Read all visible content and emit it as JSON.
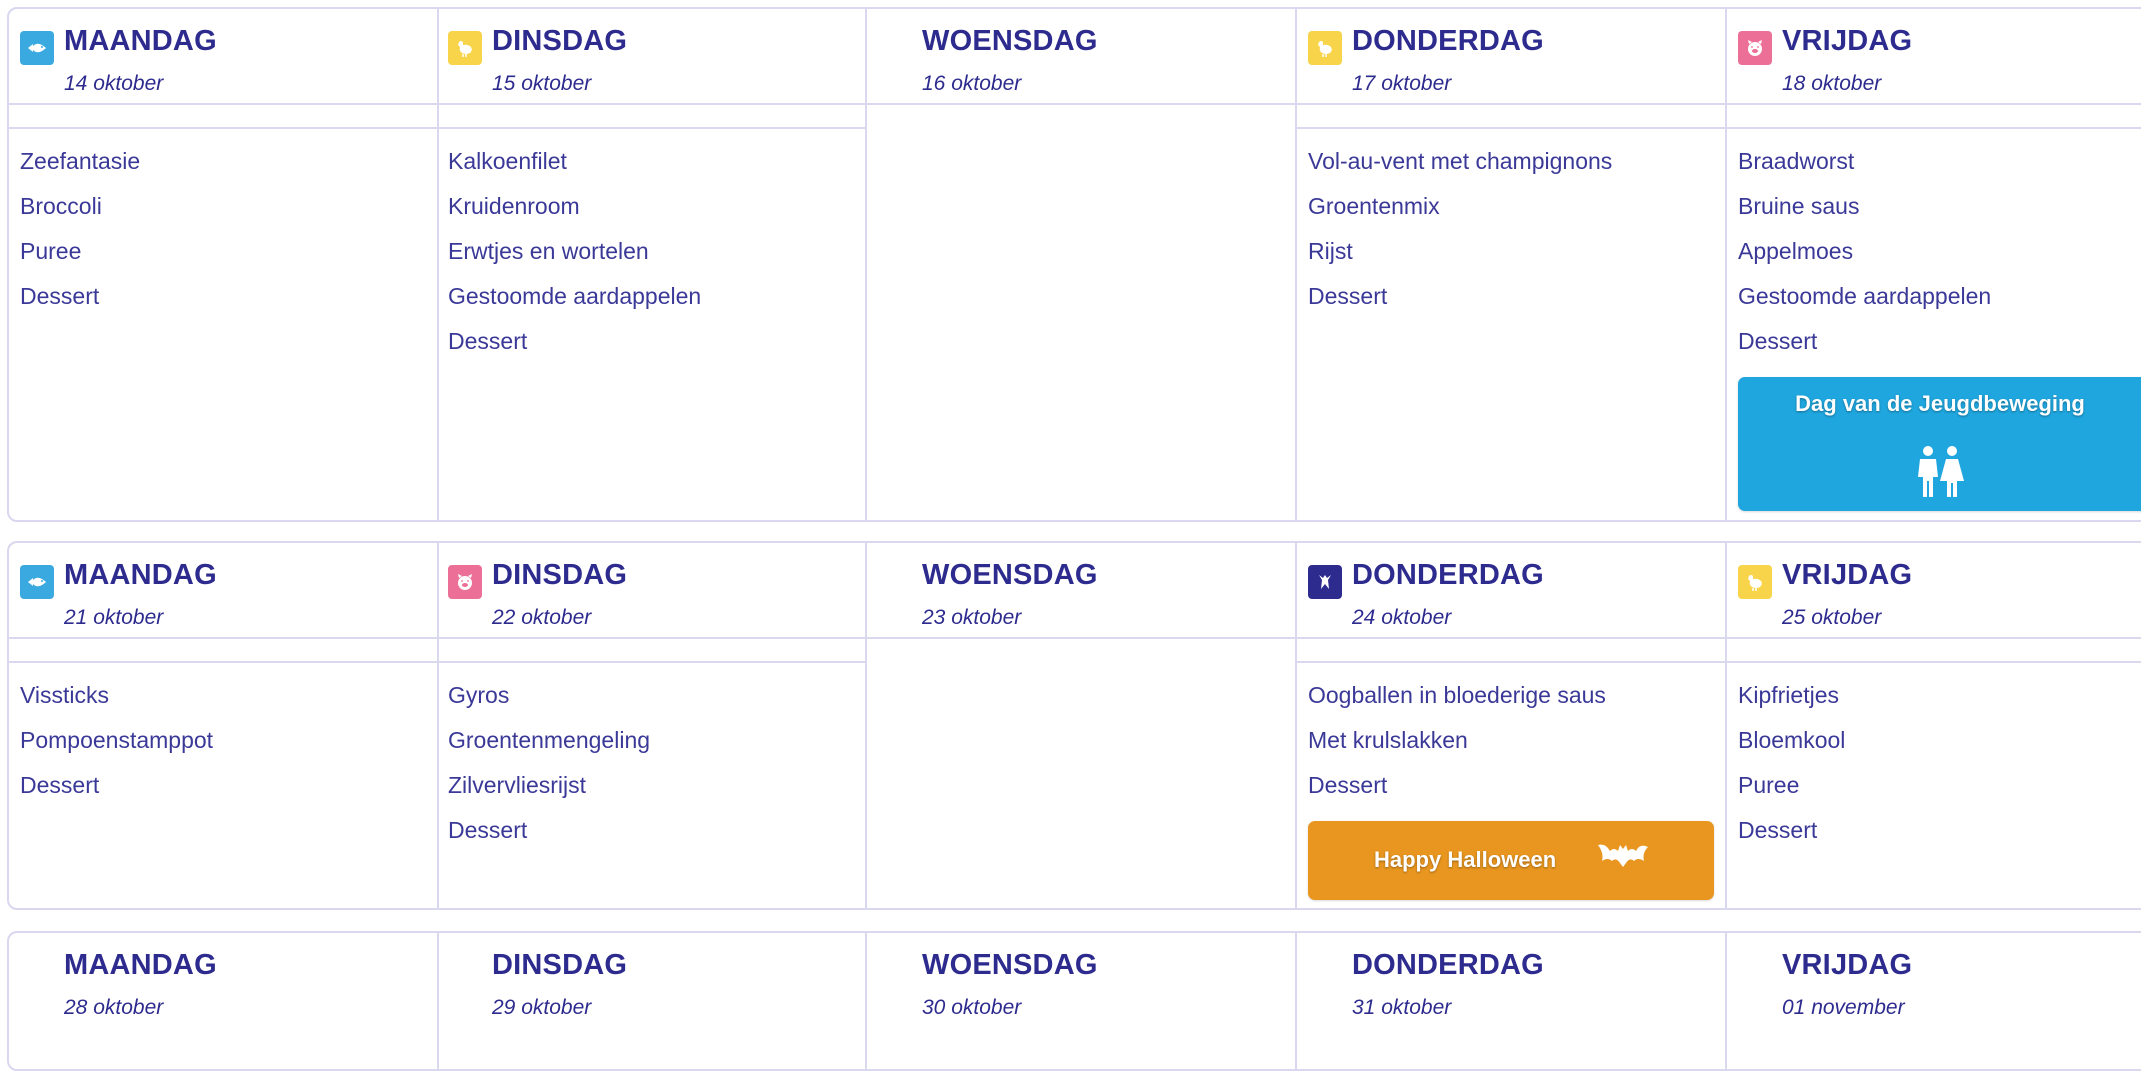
{
  "colors": {
    "primary_text": "#2e2b8f",
    "border": "#d9d8ee",
    "fish_badge": "#3aa9df",
    "poultry_badge": "#f7d44a",
    "pork_badge": "#ec6f97",
    "halloween_badge": "#2e2b8f",
    "youth_banner": "#1fa6de",
    "halloween_banner": "#e8961f"
  },
  "weeks": [
    {
      "days": [
        {
          "name": "MAANDAG",
          "date": "14 oktober",
          "icon": "fish-icon",
          "items": [
            "Zeefantasie",
            "Broccoli",
            "Puree",
            "Dessert"
          ]
        },
        {
          "name": "DINSDAG",
          "date": "15 oktober",
          "icon": "chicken-icon",
          "items": [
            "Kalkoenfilet",
            "Kruidenroom",
            "Erwtjes en wortelen",
            "Gestoomde aardappelen",
            "Dessert"
          ]
        },
        {
          "name": "WOENSDAG",
          "date": "16 oktober",
          "icon": "",
          "items": []
        },
        {
          "name": "DONDERDAG",
          "date": "17 oktober",
          "icon": "chicken-icon",
          "items": [
            "Vol-au-vent met champignons",
            "Groentenmix",
            "Rijst",
            "Dessert"
          ]
        },
        {
          "name": "VRIJDAG",
          "date": "18 oktober",
          "icon": "pig-icon",
          "items": [
            "Braadworst",
            "Bruine saus",
            "Appelmoes",
            "Gestoomde aardappelen",
            "Dessert"
          ],
          "banner": {
            "label": "Dag van de Jeugdbeweging",
            "icon": "scouts-icon"
          }
        }
      ]
    },
    {
      "days": [
        {
          "name": "MAANDAG",
          "date": "21 oktober",
          "icon": "fish-icon",
          "items": [
            "Vissticks",
            "Pompoenstamppot",
            "Dessert"
          ]
        },
        {
          "name": "DINSDAG",
          "date": "22 oktober",
          "icon": "pig-icon",
          "items": [
            "Gyros",
            "Groentenmengeling",
            "Zilvervliesrijst",
            "Dessert"
          ]
        },
        {
          "name": "WOENSDAG",
          "date": "23 oktober",
          "icon": "",
          "items": []
        },
        {
          "name": "DONDERDAG",
          "date": "24 oktober",
          "icon": "halloween-icon",
          "items": [
            "Oogballen in bloederige saus",
            "Met krulslakken",
            "Dessert"
          ],
          "banner": {
            "label": "Happy Halloween",
            "icon": "bat-icon"
          }
        },
        {
          "name": "VRIJDAG",
          "date": "25 oktober",
          "icon": "chicken-icon",
          "items": [
            "Kipfrietjes",
            "Bloemkool",
            "Puree",
            "Dessert"
          ]
        }
      ]
    },
    {
      "days": [
        {
          "name": "MAANDAG",
          "date": "28 oktober"
        },
        {
          "name": "DINSDAG",
          "date": "29 oktober"
        },
        {
          "name": "WOENSDAG",
          "date": "30 oktober"
        },
        {
          "name": "DONDERDAG",
          "date": "31 oktober"
        },
        {
          "name": "VRIJDAG",
          "date": "01 november"
        }
      ]
    }
  ]
}
